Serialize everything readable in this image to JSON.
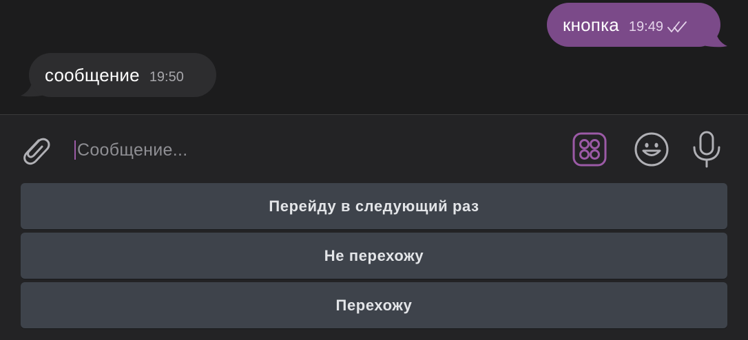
{
  "messages": {
    "outgoing": {
      "text": "кнопка",
      "time": "19:49",
      "status_icon": "double-check-read-icon",
      "bubble_color": "#7b4a89"
    },
    "incoming": {
      "text": "сообщение",
      "time": "19:50",
      "bubble_color": "#2d2d2f"
    }
  },
  "composer": {
    "placeholder": "Сообщение...",
    "attach_icon": "paperclip-icon",
    "bot_keyboard_icon": "bot-keyboard-icon",
    "emoji_icon": "emoji-smile-icon",
    "mic_icon": "microphone-icon",
    "accent_color": "#9b5aa6"
  },
  "reply_keyboard": {
    "buttons": [
      "Перейду в следующий раз",
      "Не перехожу",
      "Перехожу"
    ],
    "button_color": "#3e434b"
  }
}
